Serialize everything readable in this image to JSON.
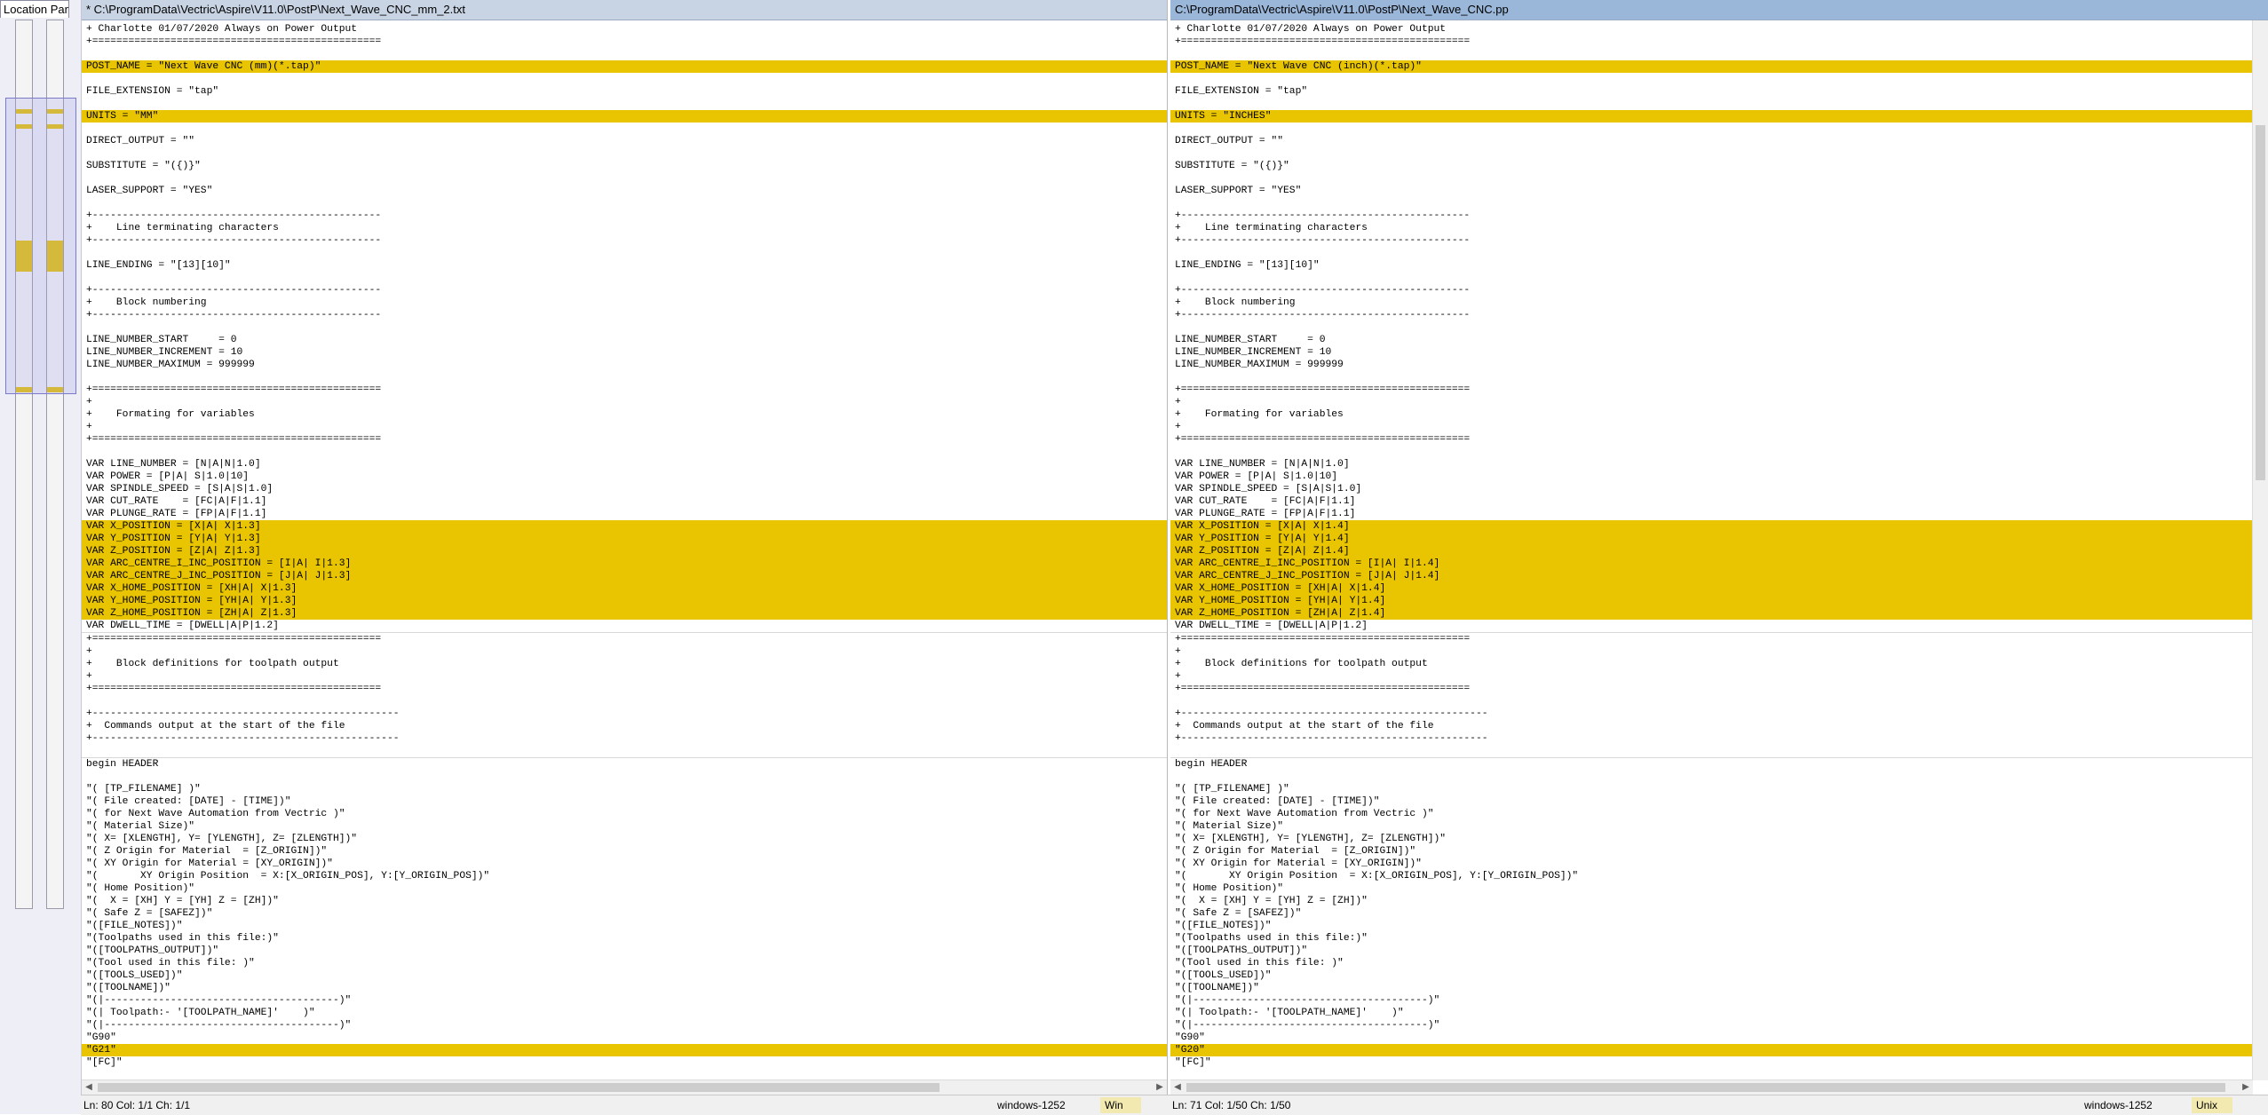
{
  "location_pane": {
    "title": "Location Pane"
  },
  "left": {
    "title": "* C:\\ProgramData\\Vectric\\Aspire\\V11.0\\PostP\\Next_Wave_CNC_mm_2.txt",
    "lines": [
      "+ Charlotte 01/07/2020 Always on Power Output",
      "+================================================",
      "",
      "POST_NAME = \"Next Wave CNC (mm)(*.tap)\"",
      "",
      "FILE_EXTENSION = \"tap\"",
      "",
      "UNITS = \"MM\"",
      "",
      "DIRECT_OUTPUT = \"\"",
      "",
      "SUBSTITUTE = \"({)}\"",
      "",
      "LASER_SUPPORT = \"YES\"",
      "",
      "+------------------------------------------------",
      "+    Line terminating characters",
      "+------------------------------------------------",
      "",
      "LINE_ENDING = \"[13][10]\"",
      "",
      "+------------------------------------------------",
      "+    Block numbering",
      "+------------------------------------------------",
      "",
      "LINE_NUMBER_START     = 0",
      "LINE_NUMBER_INCREMENT = 10",
      "LINE_NUMBER_MAXIMUM = 999999",
      "",
      "+================================================",
      "+",
      "+    Formating for variables",
      "+",
      "+================================================",
      "",
      "VAR LINE_NUMBER = [N|A|N|1.0]",
      "VAR POWER = [P|A| S|1.0|10]",
      "VAR SPINDLE_SPEED = [S|A|S|1.0]",
      "VAR CUT_RATE    = [FC|A|F|1.1]",
      "VAR PLUNGE_RATE = [FP|A|F|1.1]",
      "VAR X_POSITION = [X|A| X|1.3]",
      "VAR Y_POSITION = [Y|A| Y|1.3]",
      "VAR Z_POSITION = [Z|A| Z|1.3]",
      "VAR ARC_CENTRE_I_INC_POSITION = [I|A| I|1.3]",
      "VAR ARC_CENTRE_J_INC_POSITION = [J|A| J|1.3]",
      "VAR X_HOME_POSITION = [XH|A| X|1.3]",
      "VAR Y_HOME_POSITION = [YH|A| Y|1.3]",
      "VAR Z_HOME_POSITION = [ZH|A| Z|1.3]",
      "VAR DWELL_TIME = [DWELL|A|P|1.2]",
      "+================================================",
      "+",
      "+    Block definitions for toolpath output",
      "+",
      "+================================================",
      "",
      "+---------------------------------------------------",
      "+  Commands output at the start of the file",
      "+---------------------------------------------------",
      "",
      "begin HEADER",
      "",
      "\"( [TP_FILENAME] )\"",
      "\"( File created: [DATE] - [TIME])\"",
      "\"( for Next Wave Automation from Vectric )\"",
      "\"( Material Size)\"",
      "\"( X= [XLENGTH], Y= [YLENGTH], Z= [ZLENGTH])\"",
      "\"( Z Origin for Material  = [Z_ORIGIN])\"",
      "\"( XY Origin for Material = [XY_ORIGIN])\"",
      "\"(       XY Origin Position  = X:[X_ORIGIN_POS], Y:[Y_ORIGIN_POS])\"",
      "\"( Home Position)\"",
      "\"(  X = [XH] Y = [YH] Z = [ZH])\"",
      "\"( Safe Z = [SAFEZ])\"",
      "\"([FILE_NOTES])\"",
      "\"(Toolpaths used in this file:)\"",
      "\"([TOOLPATHS_OUTPUT])\"",
      "\"(Tool used in this file: )\"",
      "\"([TOOLS_USED])\"",
      "\"([TOOLNAME])\"",
      "\"(|---------------------------------------)\"",
      "\"(| Toolpath:- '[TOOLPATH_NAME]'    )\"",
      "\"(|---------------------------------------)\"",
      "\"G90\"",
      "\"G21\"",
      "\"[FC]\""
    ],
    "status": {
      "position": "Ln: 80  Col: 1/1  Ch: 1/1",
      "encoding": "windows-1252",
      "line_endings": "Win"
    }
  },
  "right": {
    "title": "C:\\ProgramData\\Vectric\\Aspire\\V11.0\\PostP\\Next_Wave_CNC.pp",
    "lines": [
      "+ Charlotte 01/07/2020 Always on Power Output",
      "+================================================",
      "",
      "POST_NAME = \"Next Wave CNC (inch)(*.tap)\"",
      "",
      "FILE_EXTENSION = \"tap\"",
      "",
      "UNITS = \"INCHES\"",
      "",
      "DIRECT_OUTPUT = \"\"",
      "",
      "SUBSTITUTE = \"({)}\"",
      "",
      "LASER_SUPPORT = \"YES\"",
      "",
      "+------------------------------------------------",
      "+    Line terminating characters",
      "+------------------------------------------------",
      "",
      "LINE_ENDING = \"[13][10]\"",
      "",
      "+------------------------------------------------",
      "+    Block numbering",
      "+------------------------------------------------",
      "",
      "LINE_NUMBER_START     = 0",
      "LINE_NUMBER_INCREMENT = 10",
      "LINE_NUMBER_MAXIMUM = 999999",
      "",
      "+================================================",
      "+",
      "+    Formating for variables",
      "+",
      "+================================================",
      "",
      "VAR LINE_NUMBER = [N|A|N|1.0]",
      "VAR POWER = [P|A| S|1.0|10]",
      "VAR SPINDLE_SPEED = [S|A|S|1.0]",
      "VAR CUT_RATE    = [FC|A|F|1.1]",
      "VAR PLUNGE_RATE = [FP|A|F|1.1]",
      "VAR X_POSITION = [X|A| X|1.4]",
      "VAR Y_POSITION = [Y|A| Y|1.4]",
      "VAR Z_POSITION = [Z|A| Z|1.4]",
      "VAR ARC_CENTRE_I_INC_POSITION = [I|A| I|1.4]",
      "VAR ARC_CENTRE_J_INC_POSITION = [J|A| J|1.4]",
      "VAR X_HOME_POSITION = [XH|A| X|1.4]",
      "VAR Y_HOME_POSITION = [YH|A| Y|1.4]",
      "VAR Z_HOME_POSITION = [ZH|A| Z|1.4]",
      "VAR DWELL_TIME = [DWELL|A|P|1.2]",
      "+================================================",
      "+",
      "+    Block definitions for toolpath output",
      "+",
      "+================================================",
      "",
      "+---------------------------------------------------",
      "+  Commands output at the start of the file",
      "+---------------------------------------------------",
      "",
      "begin HEADER",
      "",
      "\"( [TP_FILENAME] )\"",
      "\"( File created: [DATE] - [TIME])\"",
      "\"( for Next Wave Automation from Vectric )\"",
      "\"( Material Size)\"",
      "\"( X= [XLENGTH], Y= [YLENGTH], Z= [ZLENGTH])\"",
      "\"( Z Origin for Material  = [Z_ORIGIN])\"",
      "\"( XY Origin for Material = [XY_ORIGIN])\"",
      "\"(       XY Origin Position  = X:[X_ORIGIN_POS], Y:[Y_ORIGIN_POS])\"",
      "\"( Home Position)\"",
      "\"(  X = [XH] Y = [YH] Z = [ZH])\"",
      "\"( Safe Z = [SAFEZ])\"",
      "\"([FILE_NOTES])\"",
      "\"(Toolpaths used in this file:)\"",
      "\"([TOOLPATHS_OUTPUT])\"",
      "\"(Tool used in this file: )\"",
      "\"([TOOLS_USED])\"",
      "\"([TOOLNAME])\"",
      "\"(|---------------------------------------)\"",
      "\"(| Toolpath:- '[TOOLPATH_NAME]'    )\"",
      "\"(|---------------------------------------)\"",
      "\"G90\"",
      "\"G20\"",
      "\"[FC]\""
    ],
    "status": {
      "position": "Ln: 71  Col: 1/50  Ch: 1/50",
      "encoding": "windows-1252",
      "line_endings": "Unix"
    }
  },
  "diff_color": "#e9c400"
}
